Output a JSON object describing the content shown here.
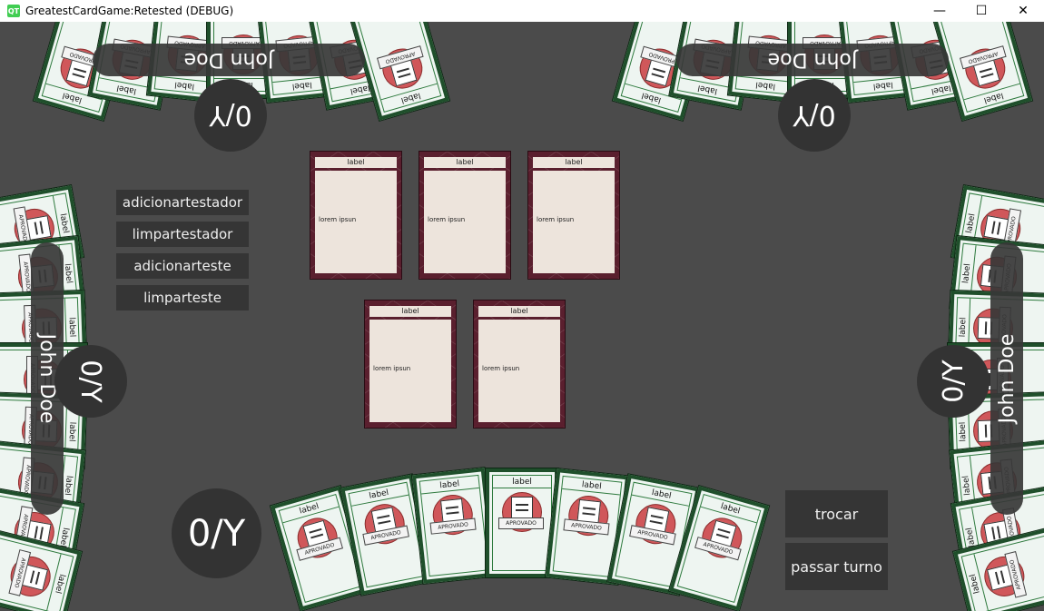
{
  "window": {
    "title": "GreatestCardGame:Retested (DEBUG)",
    "app_icon_text": "QT",
    "minimize": "—",
    "maximize": "☐",
    "close": "✕"
  },
  "debug_buttons": [
    "adicionartestador",
    "limpartestador",
    "adicionarteste",
    "limparteste"
  ],
  "actions": {
    "trocar": "trocar",
    "passar_turno": "passar turno"
  },
  "players": {
    "self": {
      "score": "0/Y"
    },
    "top_left": {
      "name": "John Doe",
      "score": "0/Y"
    },
    "top_right": {
      "name": "John Doe",
      "score": "0/Y"
    },
    "left": {
      "name": "John Doe",
      "score": "0/Y"
    },
    "right": {
      "name": "John Doe",
      "score": "0/Y"
    }
  },
  "table_cards": [
    {
      "label": "label",
      "text": "lorem ipsun"
    },
    {
      "label": "label",
      "text": "lorem ipsun"
    },
    {
      "label": "label",
      "text": "lorem ipsun"
    },
    {
      "label": "label",
      "text": "lorem ipsun"
    },
    {
      "label": "label",
      "text": "lorem ipsun"
    }
  ],
  "hand_card": {
    "label": "label",
    "stamp": "APROVADO"
  },
  "colors": {
    "background": "#4b4b4b",
    "card_green": "#1f4f2b",
    "card_red": "#5a1f2e",
    "button": "#353535"
  }
}
